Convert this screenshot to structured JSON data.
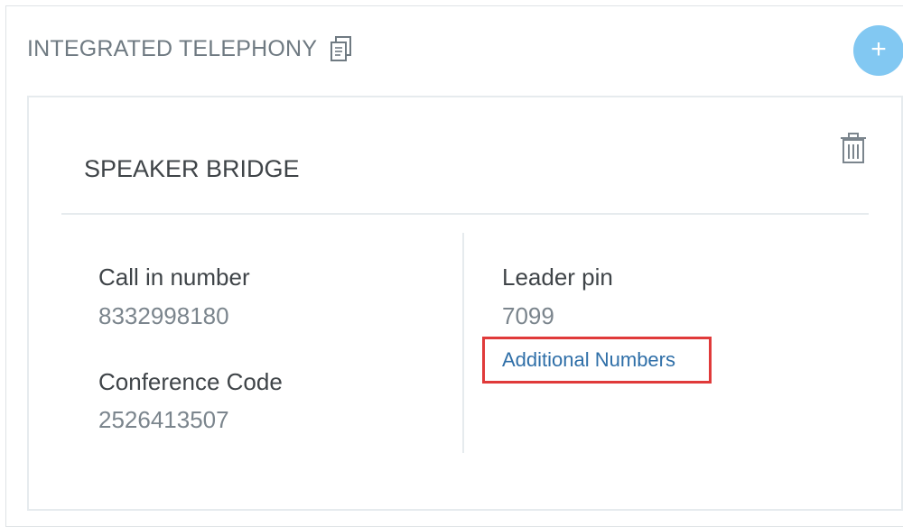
{
  "section": {
    "title": "INTEGRATED TELEPHONY",
    "add_label": "+"
  },
  "card": {
    "title": "SPEAKER BRIDGE",
    "fields": {
      "call_in_number": {
        "label": "Call in number",
        "value": "8332998180"
      },
      "conference_code": {
        "label": "Conference Code",
        "value": "2526413507"
      },
      "leader_pin": {
        "label": "Leader pin",
        "value": "7099"
      }
    },
    "additional_numbers_link": "Additional Numbers"
  },
  "icons": {
    "copy": "copy-icon",
    "add": "plus-icon",
    "delete": "trash-icon"
  },
  "colors": {
    "accent": "#82c8f2",
    "link": "#2f6fa8",
    "highlight": "#e03a3a"
  }
}
